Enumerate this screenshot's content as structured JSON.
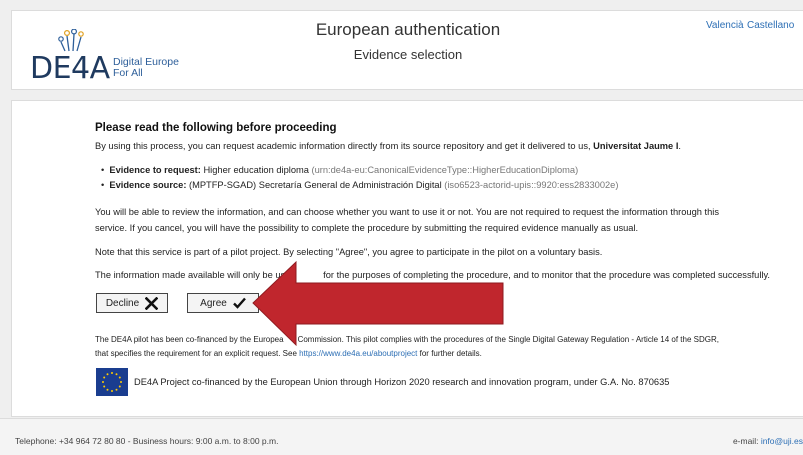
{
  "header": {
    "logo_text": "DE4A",
    "logo_sub_line1": "Digital Europe",
    "logo_sub_line2": "For All",
    "title": "European authentication",
    "subtitle": "Evidence selection",
    "languages": [
      "Valencià",
      "Castellano"
    ]
  },
  "content": {
    "heading": "Please read the following before proceeding",
    "intro_prefix": "By using this process, you can request academic information directly from its source repository and get it delivered to us, ",
    "intro_org": "Universitat Jaume I",
    "intro_suffix": ".",
    "bullets": [
      {
        "label": "Evidence to request:",
        "value": "Higher education diploma",
        "code": "(urn:de4a-eu:CanonicalEvidenceType::HigherEducationDiploma)"
      },
      {
        "label": "Evidence source:",
        "value": "(MPTFP-SGAD) Secretaría General de Administración Digital",
        "code": "(iso6523-actorid-upis::9920:ess2833002e)"
      }
    ],
    "review_line1": "You will be able to review the information, and can choose whether you want to use it or not. You are not required to request the information through this",
    "review_line2": "service. If you cancel, you will have the possibility to complete the procedure by submitting the required evidence manually as usual.",
    "pilot_note": "Note that this service is part of a pilot project. By selecting \"Agree\", you agree to participate in the pilot on a voluntary basis.",
    "info_prefix": "The information made available will only be us",
    "info_suffix": "for the purposes of completing the procedure, and to monitor that the procedure was completed successfully.",
    "decline_label": "Decline",
    "agree_label": "Agree",
    "cofinance_line1_prefix": "The DE4A pilot has been co-financed by the Europea",
    "cofinance_line1_suffix": "Commission. This pilot complies with the procedures of the Single Digital Gateway Regulation - Article 14 of the SDGR,",
    "cofinance_line2_prefix": "that specifies the requirement for an explicit request. See ",
    "cofinance_link": "https://www.de4a.eu/aboutproject",
    "cofinance_line2_suffix": " for further details.",
    "eu_text": "DE4A Project co-financed by the European Union through Horizon 2020 research and innovation program, under G.A. No. 870635"
  },
  "footer": {
    "telephone": "Telephone: +34 964 72 80 80 - Business hours: 9:00 a.m. to 8:00 p.m.",
    "email_prefix": "e-mail: ",
    "email": "info@uji.es"
  },
  "colors": {
    "arrow": "#c0262d",
    "link": "#2d6fb5",
    "eu_flag": "#1a3d8f",
    "eu_stars": "#ffcc00"
  }
}
